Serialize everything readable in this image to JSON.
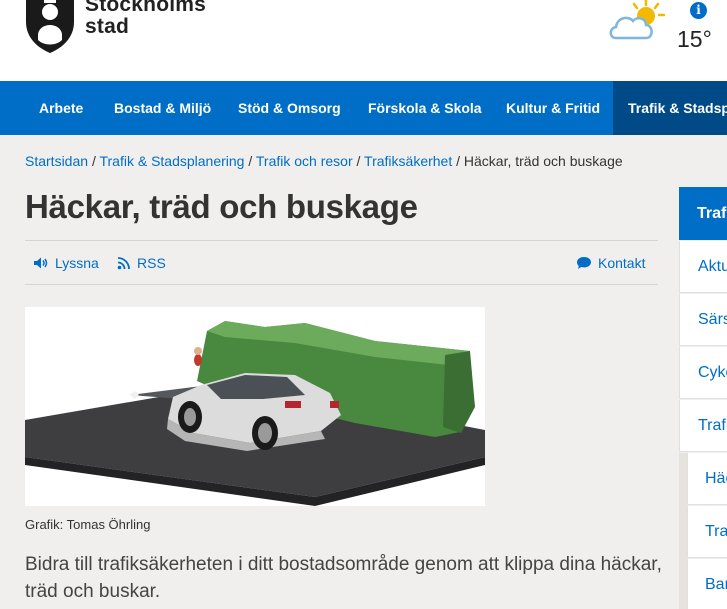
{
  "brand": {
    "name_line1": "Stockholms",
    "name_line2": "stad"
  },
  "weather": {
    "temperature": "15°",
    "icon": "sun-cloud-icon",
    "info": "i"
  },
  "nav": {
    "items": [
      {
        "label": "Arbete"
      },
      {
        "label": "Bostad & Miljö"
      },
      {
        "label": "Stöd & Omsorg"
      },
      {
        "label": "Förskola & Skola"
      },
      {
        "label": "Kultur & Fritid"
      },
      {
        "label": "Trafik & Stadsplanering"
      }
    ],
    "active_index": 5
  },
  "breadcrumb": {
    "items": [
      "Startsidan",
      "Trafik & Stadsplanering",
      "Trafik och resor",
      "Trafiksäkerhet"
    ],
    "separator": "/",
    "current": "Häckar, träd och buskage"
  },
  "page": {
    "title": "Häckar, träd och buskage",
    "listen_label": "Lyssna",
    "rss_label": "RSS",
    "contact_label": "Kontakt",
    "image_caption": "Grafik: Tomas Öhrling",
    "lead": "Bidra till trafiksäkerheten i ditt bostadsområde genom att klippa dina häckar, träd och buskar."
  },
  "sidebar": {
    "header": "Trafik och resor",
    "items": [
      "Aktuellt",
      "Särskilda",
      "Cykel",
      "Trafiksäkerhet"
    ],
    "sub_items": [
      "Häckar",
      "Trafik",
      "Barn"
    ]
  },
  "colors": {
    "primary": "#006ec6",
    "nav_active": "#004b87",
    "background": "#f1efed"
  }
}
